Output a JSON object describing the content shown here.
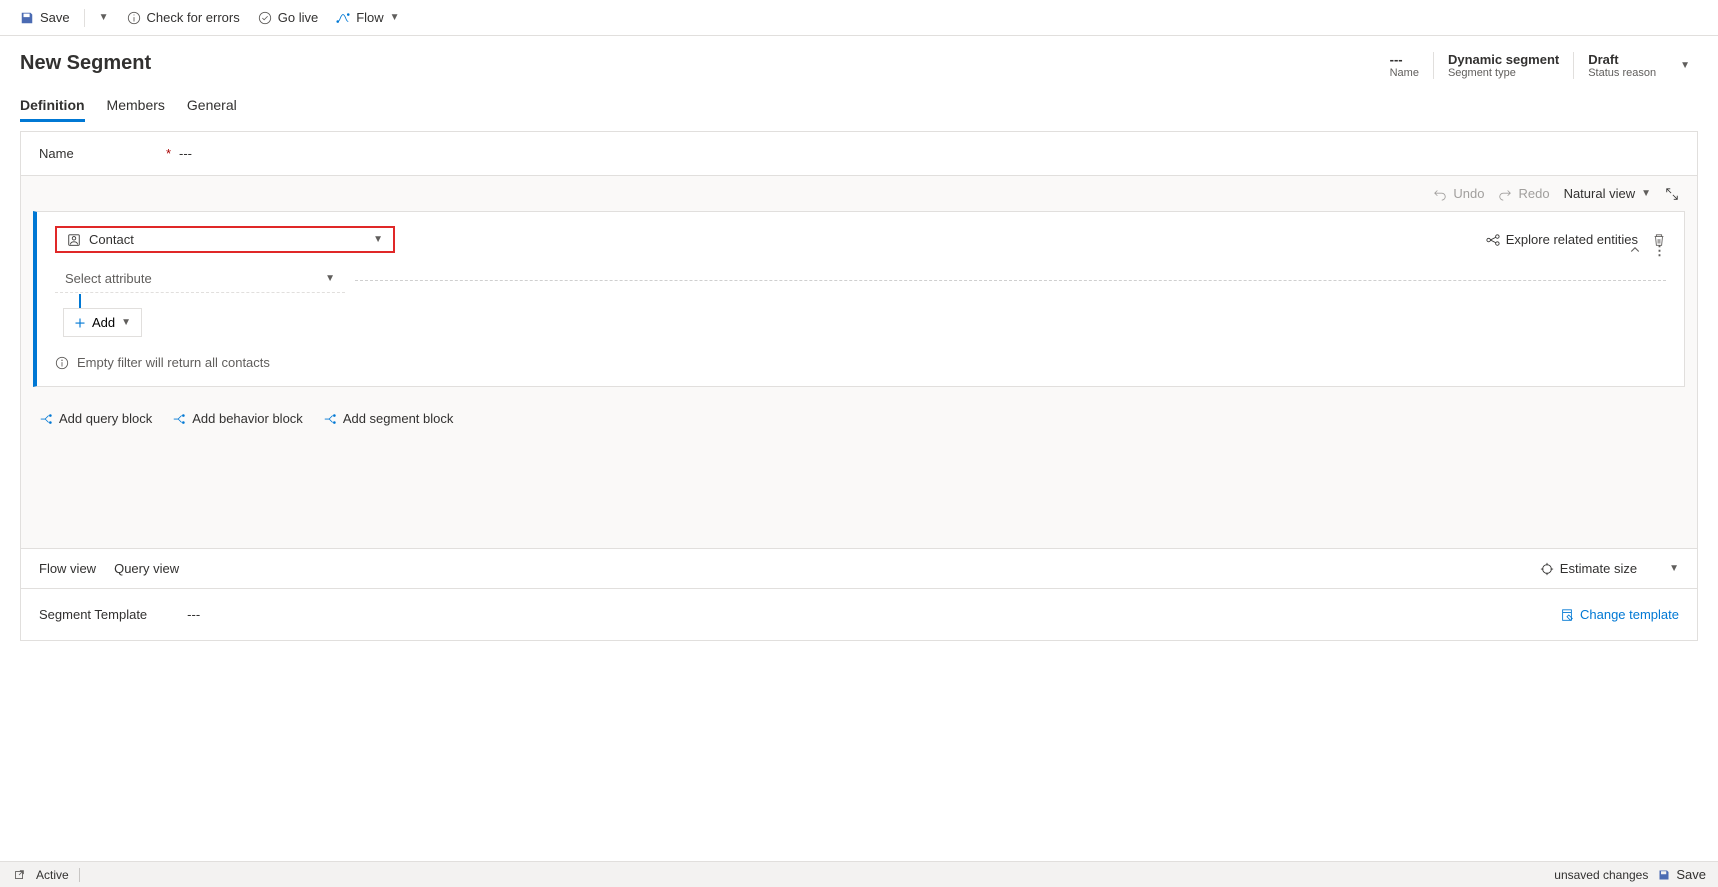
{
  "toolbar": {
    "save": "Save",
    "check_errors": "Check for errors",
    "go_live": "Go live",
    "flow": "Flow"
  },
  "header": {
    "title": "New Segment",
    "meta": [
      {
        "value": "---",
        "label": "Name"
      },
      {
        "value": "Dynamic segment",
        "label": "Segment type"
      },
      {
        "value": "Draft",
        "label": "Status reason"
      }
    ]
  },
  "tabs": [
    "Definition",
    "Members",
    "General"
  ],
  "form": {
    "name_label": "Name",
    "name_value": "---"
  },
  "builder": {
    "undo": "Undo",
    "redo": "Redo",
    "view_mode": "Natural view",
    "contact_label": "Contact",
    "explore_related": "Explore related entities",
    "select_attribute": "Select attribute",
    "add": "Add",
    "empty_hint": "Empty filter will return all contacts",
    "add_query": "Add query block",
    "add_behavior": "Add behavior block",
    "add_segment": "Add segment block"
  },
  "footer": {
    "flow_view": "Flow view",
    "query_view": "Query view",
    "estimate_size": "Estimate size",
    "segment_template_label": "Segment Template",
    "segment_template_value": "---",
    "change_template": "Change template"
  },
  "statusbar": {
    "status": "Active",
    "unsaved": "unsaved changes",
    "save": "Save"
  }
}
